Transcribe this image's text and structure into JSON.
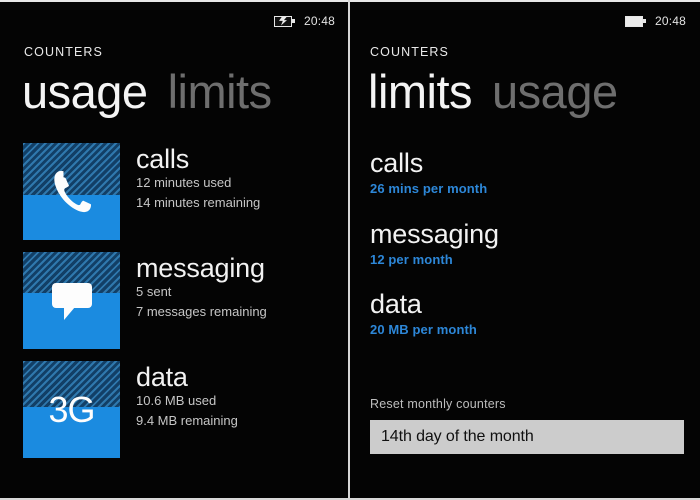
{
  "theme": {
    "background": "#040404",
    "accent": "#1b8be0",
    "accent_text": "#2d87d8",
    "tile_hatch": "#1d5584",
    "foreground": "#f2f2f2",
    "muted": "#6e6e6e",
    "select_background": "#cccccc"
  },
  "left_screen": {
    "status": {
      "battery_icon": "battery-charging-icon",
      "clock": "20:48"
    },
    "app_title": "COUNTERS",
    "pivot": {
      "active": "usage",
      "inactive": "limits"
    },
    "items": [
      {
        "icon": "phone-handset-icon",
        "name": "calls",
        "used_text": "12 minutes used",
        "remaining_text": "14 minutes remaining",
        "fill_percent": 46
      },
      {
        "icon": "speech-bubble-icon",
        "name": "messaging",
        "used_text": "5 sent",
        "remaining_text": "7 messages remaining",
        "fill_percent": 58
      },
      {
        "icon": "3g-network-icon",
        "icon_text": "3G",
        "name": "data",
        "used_text": "10.6 MB used",
        "remaining_text": "9.4 MB remaining",
        "fill_percent": 53
      }
    ]
  },
  "right_screen": {
    "status": {
      "battery_icon": "battery-full-icon",
      "clock": "20:48"
    },
    "app_title": "COUNTERS",
    "pivot": {
      "active": "limits",
      "inactive": "usage"
    },
    "items": [
      {
        "name": "calls",
        "value": "26 mins per month"
      },
      {
        "name": "messaging",
        "value": "12 per month"
      },
      {
        "name": "data",
        "value": "20 MB per month"
      }
    ],
    "reset": {
      "label": "Reset monthly counters",
      "selected": "14th day of the month"
    }
  }
}
